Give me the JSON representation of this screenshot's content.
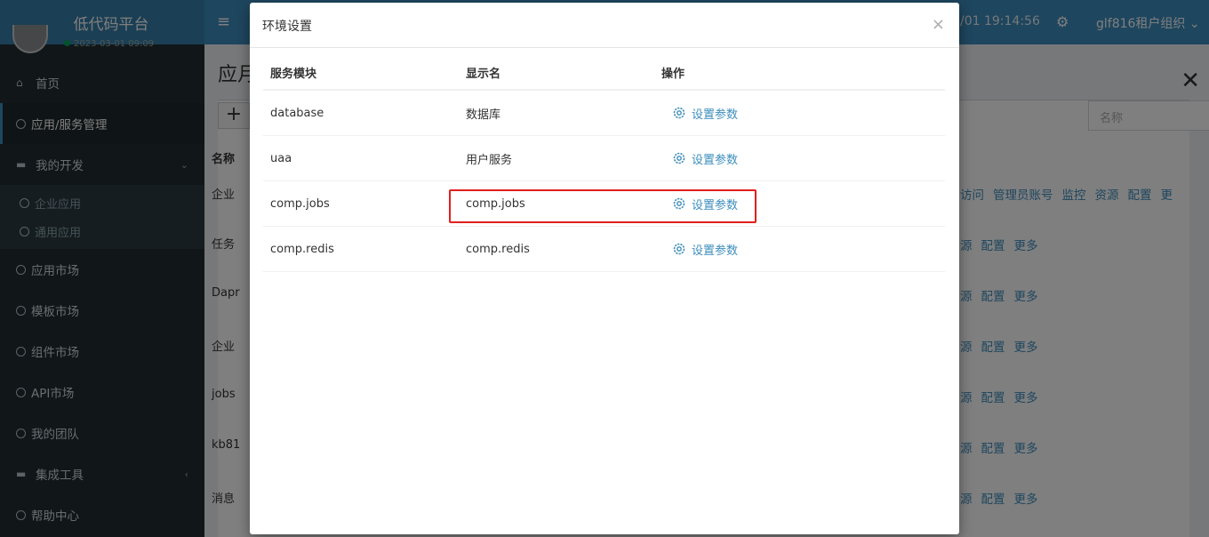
{
  "sidebar": {
    "brand": "低代码平台",
    "user_date": "2023-03-01 09:09",
    "items": [
      {
        "label": "首页",
        "icon": "home-icon"
      },
      {
        "label": "应用/服务管理",
        "icon": "circle-icon"
      },
      {
        "label": "我的开发",
        "icon": "folder-icon"
      },
      {
        "label": "企业应用",
        "icon": "circle-icon"
      },
      {
        "label": "通用应用",
        "icon": "circle-icon"
      },
      {
        "label": "应用市场",
        "icon": "circle-icon"
      },
      {
        "label": "模板市场",
        "icon": "circle-icon"
      },
      {
        "label": "组件市场",
        "icon": "circle-icon"
      },
      {
        "label": "API市场",
        "icon": "circle-icon"
      },
      {
        "label": "我的团队",
        "icon": "circle-icon"
      },
      {
        "label": "集成工具",
        "icon": "folder-icon"
      },
      {
        "label": "帮助中心",
        "icon": "circle-icon"
      }
    ]
  },
  "topbar": {
    "clock": "/01 19:14:56",
    "org": "glf816租户组织 ⌄"
  },
  "content": {
    "page_title": "应月",
    "search_placeholder": "名称",
    "name_header": "名称",
    "rows": [
      "企业",
      "任务",
      "Dapr",
      "企业",
      "jobs",
      "kb81",
      "消息"
    ],
    "actions_first": [
      "访问",
      "管理员账号",
      "监控",
      "资源",
      "配置",
      "更"
    ],
    "actions_other": [
      "源",
      "配置",
      "更多"
    ]
  },
  "modal": {
    "title": "环境设置",
    "close": "×",
    "headers": {
      "module": "服务模块",
      "display": "显示名",
      "action": "操作"
    },
    "rows": [
      {
        "module": "database",
        "display": "数据库",
        "action": "设置参数"
      },
      {
        "module": "uaa",
        "display": "用户服务",
        "action": "设置参数"
      },
      {
        "module": "comp.jobs",
        "display": "comp.jobs",
        "action": "设置参数"
      },
      {
        "module": "comp.redis",
        "display": "comp.redis",
        "action": "设置参数"
      }
    ]
  },
  "colors": {
    "accent": "#3c8dbc",
    "highlight": "#e0201c",
    "sidebar": "#222d32"
  }
}
